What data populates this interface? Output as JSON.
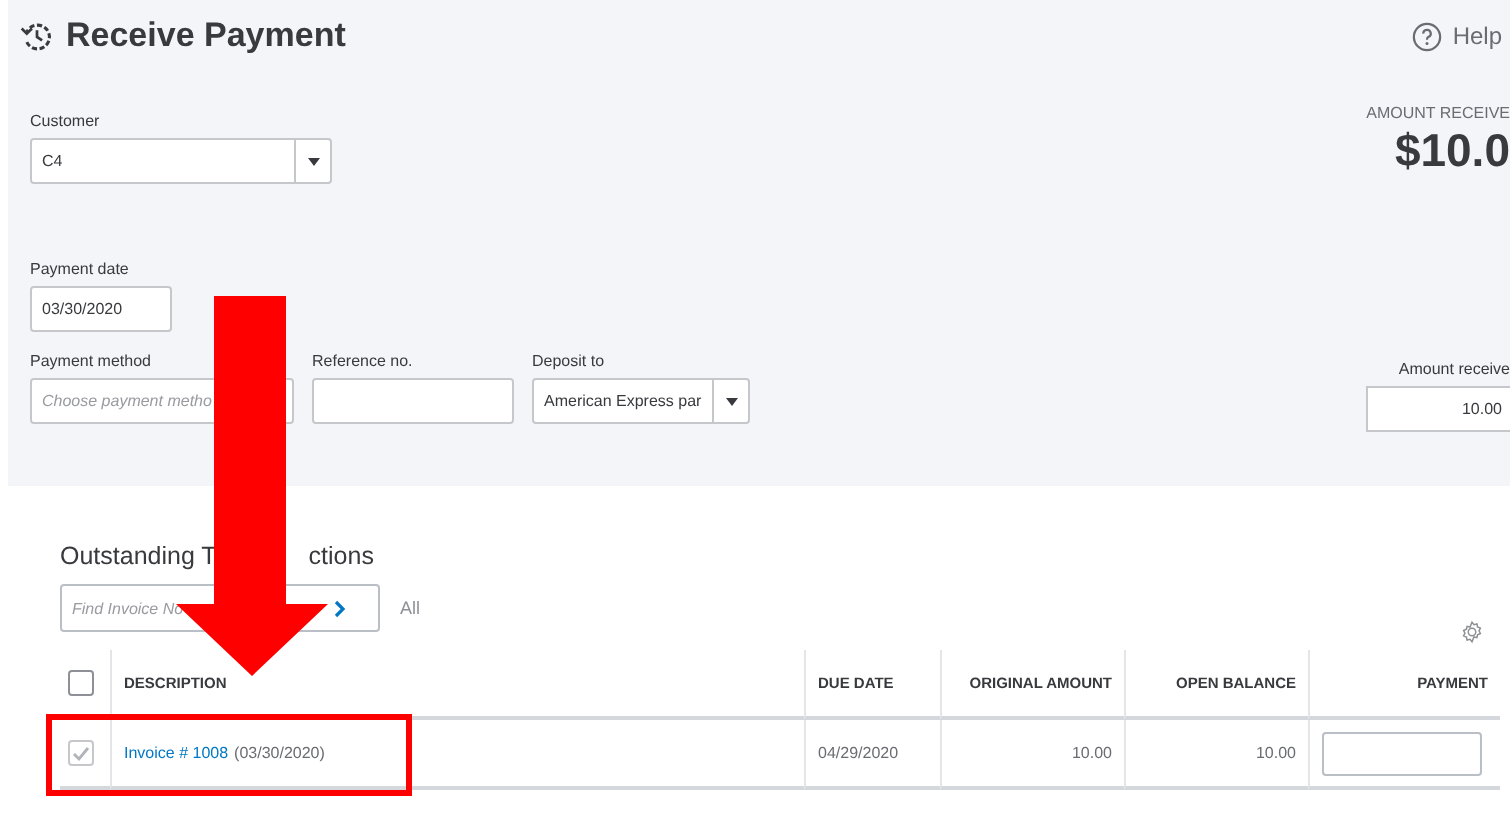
{
  "header": {
    "title": "Receive Payment",
    "help": "Help"
  },
  "amount_summary": {
    "label": "AMOUNT RECEIVE",
    "value": "$10.0"
  },
  "customer": {
    "label": "Customer",
    "value": "C4"
  },
  "payment_date": {
    "label": "Payment date",
    "value": "03/30/2020"
  },
  "payment_method": {
    "label": "Payment method",
    "placeholder": "Choose payment metho"
  },
  "reference_no": {
    "label": "Reference no."
  },
  "deposit_to": {
    "label": "Deposit to",
    "value": "American Express par"
  },
  "amount_received": {
    "label": "Amount receive",
    "value": "10.00"
  },
  "outstanding": {
    "title_start": "Outstanding T",
    "title_end": "ctions",
    "search": {
      "placeholder": "Find Invoice No"
    },
    "filter": "All",
    "columns": [
      "DESCRIPTION",
      "DUE DATE",
      "ORIGINAL AMOUNT",
      "OPEN BALANCE",
      "PAYMENT"
    ],
    "select_all": {
      "checked": false
    },
    "rows": [
      {
        "checked": true,
        "invoice_link": "Invoice # 1008",
        "date": "(03/30/2020)",
        "due_date": "04/29/2020",
        "original_amount": "10.00",
        "open_balance": "10.00"
      }
    ]
  }
}
